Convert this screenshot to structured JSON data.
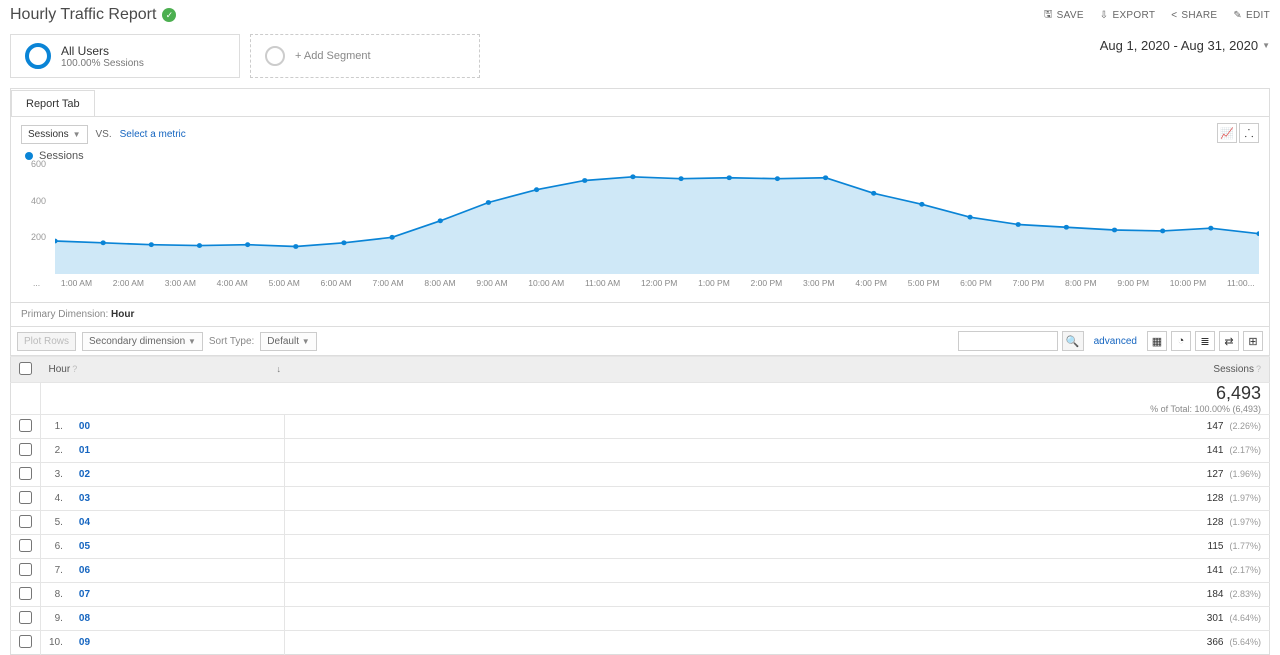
{
  "header": {
    "title": "Hourly Traffic Report",
    "actions": {
      "save": "SAVE",
      "export": "EXPORT",
      "share": "SHARE",
      "edit": "EDIT"
    }
  },
  "segments": {
    "primary": {
      "name": "All Users",
      "sub": "100.00% Sessions"
    },
    "add": "+ Add Segment"
  },
  "daterange": "Aug 1, 2020 - Aug 31, 2020",
  "tabs": [
    "Report Tab"
  ],
  "metric": {
    "selected": "Sessions",
    "vs": "VS.",
    "select_metric": "Select a metric",
    "legend": "Sessions"
  },
  "chart_data": {
    "type": "line",
    "title": "",
    "xlabel": "",
    "ylabel": "",
    "ylim": [
      0,
      600
    ],
    "yticks": [
      200,
      400,
      600
    ],
    "categories": [
      "...",
      "1:00 AM",
      "2:00 AM",
      "3:00 AM",
      "4:00 AM",
      "5:00 AM",
      "6:00 AM",
      "7:00 AM",
      "8:00 AM",
      "9:00 AM",
      "10:00 AM",
      "11:00 AM",
      "12:00 PM",
      "1:00 PM",
      "2:00 PM",
      "3:00 PM",
      "4:00 PM",
      "5:00 PM",
      "6:00 PM",
      "7:00 PM",
      "8:00 PM",
      "9:00 PM",
      "10:00 PM",
      "11:00..."
    ],
    "series": [
      {
        "name": "Sessions",
        "values": [
          180,
          170,
          160,
          155,
          160,
          150,
          170,
          200,
          290,
          390,
          460,
          510,
          530,
          520,
          525,
          520,
          525,
          440,
          380,
          310,
          270,
          255,
          240,
          235,
          250,
          220
        ]
      }
    ]
  },
  "primary_dimension": {
    "label": "Primary Dimension:",
    "value": "Hour"
  },
  "controls": {
    "plot_rows": "Plot Rows",
    "secondary_dimension": "Secondary dimension",
    "sort_type_label": "Sort Type:",
    "sort_type_value": "Default",
    "advanced": "advanced"
  },
  "table": {
    "columns": [
      "Hour",
      "Sessions"
    ],
    "total": {
      "value": "6,493",
      "sub": "% of Total: 100.00% (6,493)"
    },
    "rows": [
      {
        "idx": "1.",
        "hour": "00",
        "sessions": "147",
        "pct": "(2.26%)"
      },
      {
        "idx": "2.",
        "hour": "01",
        "sessions": "141",
        "pct": "(2.17%)"
      },
      {
        "idx": "3.",
        "hour": "02",
        "sessions": "127",
        "pct": "(1.96%)"
      },
      {
        "idx": "4.",
        "hour": "03",
        "sessions": "128",
        "pct": "(1.97%)"
      },
      {
        "idx": "5.",
        "hour": "04",
        "sessions": "128",
        "pct": "(1.97%)"
      },
      {
        "idx": "6.",
        "hour": "05",
        "sessions": "115",
        "pct": "(1.77%)"
      },
      {
        "idx": "7.",
        "hour": "06",
        "sessions": "141",
        "pct": "(2.17%)"
      },
      {
        "idx": "8.",
        "hour": "07",
        "sessions": "184",
        "pct": "(2.83%)"
      },
      {
        "idx": "9.",
        "hour": "08",
        "sessions": "301",
        "pct": "(4.64%)"
      },
      {
        "idx": "10.",
        "hour": "09",
        "sessions": "366",
        "pct": "(5.64%)"
      }
    ]
  }
}
